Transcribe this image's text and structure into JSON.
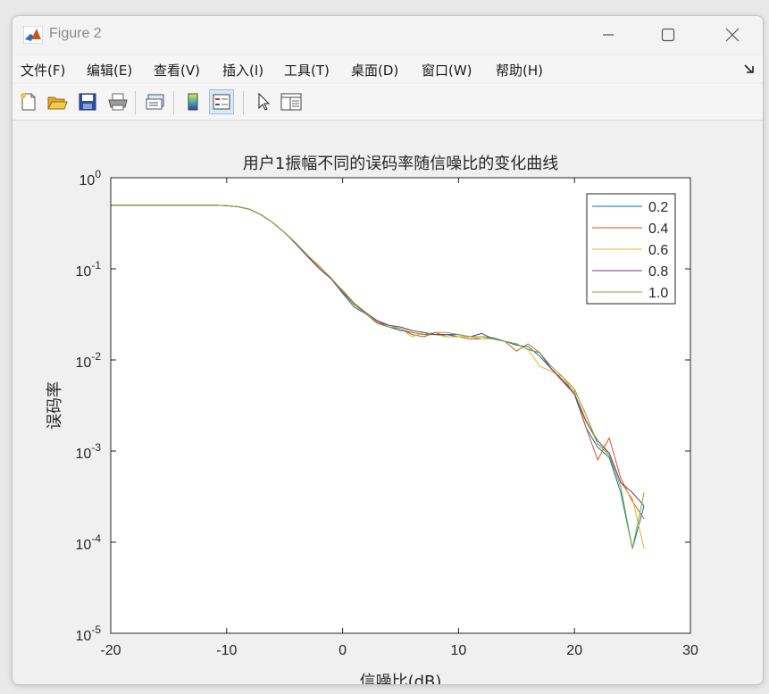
{
  "window": {
    "title": "Figure 2",
    "minimize_label": "",
    "maximize_label": "",
    "close_label": ""
  },
  "menu": {
    "items": [
      {
        "id": "file",
        "label": "文件(F)"
      },
      {
        "id": "edit",
        "label": "编辑(E)"
      },
      {
        "id": "view",
        "label": "查看(V)"
      },
      {
        "id": "insert",
        "label": "插入(I)"
      },
      {
        "id": "tools",
        "label": "工具(T)"
      },
      {
        "id": "desktop",
        "label": "桌面(D)"
      },
      {
        "id": "window",
        "label": "窗口(W)"
      },
      {
        "id": "help",
        "label": "帮助(H)"
      }
    ]
  },
  "toolbar": {
    "icons": [
      "new-figure-icon",
      "open-file-icon",
      "save-icon",
      "print-icon",
      "link-plot-icon",
      "insert-colorbar-icon",
      "insert-legend-icon",
      "edit-plot-icon",
      "property-inspector-icon"
    ]
  },
  "colors": {
    "series": [
      "#0072BD",
      "#D95319",
      "#EDB120",
      "#7E2F8E",
      "#77AC30"
    ]
  },
  "chart_data": {
    "type": "line",
    "title": "用户1振幅不同的误码率随信噪比的变化曲线",
    "xlabel": "信噪比(dB)",
    "ylabel": "误码率",
    "xlim": [
      -20,
      30
    ],
    "ylim": [
      1e-05,
      1
    ],
    "yscale": "log",
    "xticks": [
      "-20",
      "-10",
      "0",
      "10",
      "20",
      "30"
    ],
    "yticks": [
      {
        "base": "10",
        "exp": "0"
      },
      {
        "base": "10",
        "exp": "-1"
      },
      {
        "base": "10",
        "exp": "-2"
      },
      {
        "base": "10",
        "exp": "-3"
      },
      {
        "base": "10",
        "exp": "-4"
      },
      {
        "base": "10",
        "exp": "-5"
      }
    ],
    "grid": false,
    "legend_position": "top-right",
    "x": [
      -20,
      -19,
      -18,
      -17,
      -16,
      -15,
      -14,
      -13,
      -12,
      -11,
      -10,
      -9,
      -8,
      -7,
      -6,
      -5,
      -4,
      -3,
      -2,
      -1,
      0,
      1,
      2,
      3,
      4,
      5,
      6,
      7,
      8,
      9,
      10,
      11,
      12,
      13,
      14,
      15,
      16,
      17,
      18,
      19,
      20,
      21,
      22,
      23,
      24,
      25,
      26
    ],
    "series": [
      {
        "name": "0.2",
        "values": [
          0.5,
          0.5,
          0.5,
          0.5,
          0.5,
          0.5,
          0.5,
          0.5,
          0.5,
          0.5,
          0.495,
          0.48,
          0.45,
          0.39,
          0.32,
          0.25,
          0.19,
          0.14,
          0.105,
          0.078,
          0.054,
          0.038,
          0.032,
          0.026,
          0.023,
          0.021,
          0.02,
          0.019,
          0.019,
          0.019,
          0.018,
          0.018,
          0.018,
          0.0175,
          0.016,
          0.0145,
          0.014,
          0.011,
          0.008,
          0.006,
          0.0042,
          0.0018,
          0.0011,
          0.00085,
          0.00035,
          8.5e-05,
          0.00025
        ]
      },
      {
        "name": "0.4",
        "values": [
          0.5,
          0.5,
          0.5,
          0.5,
          0.5,
          0.5,
          0.5,
          0.5,
          0.5,
          0.5,
          0.495,
          0.48,
          0.45,
          0.39,
          0.32,
          0.25,
          0.19,
          0.135,
          0.105,
          0.078,
          0.058,
          0.042,
          0.033,
          0.026,
          0.024,
          0.022,
          0.019,
          0.018,
          0.02,
          0.018,
          0.018,
          0.017,
          0.017,
          0.017,
          0.016,
          0.0125,
          0.015,
          0.012,
          0.008,
          0.006,
          0.0045,
          0.0018,
          0.0008,
          0.0014,
          0.0005,
          0.00028,
          0.00018
        ]
      },
      {
        "name": "0.6",
        "values": [
          0.5,
          0.5,
          0.5,
          0.5,
          0.5,
          0.5,
          0.5,
          0.5,
          0.5,
          0.5,
          0.495,
          0.48,
          0.45,
          0.39,
          0.32,
          0.25,
          0.19,
          0.14,
          0.108,
          0.078,
          0.055,
          0.04,
          0.032,
          0.027,
          0.024,
          0.022,
          0.018,
          0.02,
          0.019,
          0.018,
          0.018,
          0.018,
          0.017,
          0.017,
          0.016,
          0.015,
          0.013,
          0.0085,
          0.0075,
          0.0065,
          0.0044,
          0.0022,
          0.0012,
          0.00095,
          0.00045,
          0.0003,
          8.5e-05
        ]
      },
      {
        "name": "0.8",
        "values": [
          0.5,
          0.5,
          0.5,
          0.5,
          0.5,
          0.5,
          0.5,
          0.5,
          0.5,
          0.5,
          0.495,
          0.48,
          0.45,
          0.39,
          0.32,
          0.25,
          0.185,
          0.135,
          0.1,
          0.078,
          0.055,
          0.041,
          0.033,
          0.027,
          0.024,
          0.023,
          0.021,
          0.02,
          0.019,
          0.019,
          0.019,
          0.018,
          0.0195,
          0.017,
          0.016,
          0.015,
          0.013,
          0.012,
          0.008,
          0.0058,
          0.0042,
          0.0021,
          0.0013,
          0.00095,
          0.00045,
          0.00035,
          0.00025
        ]
      },
      {
        "name": "1.0",
        "values": [
          0.5,
          0.5,
          0.5,
          0.5,
          0.5,
          0.5,
          0.5,
          0.5,
          0.5,
          0.5,
          0.495,
          0.48,
          0.45,
          0.39,
          0.32,
          0.25,
          0.19,
          0.14,
          0.105,
          0.08,
          0.057,
          0.041,
          0.032,
          0.025,
          0.023,
          0.022,
          0.02,
          0.019,
          0.02,
          0.02,
          0.019,
          0.018,
          0.018,
          0.017,
          0.016,
          0.015,
          0.013,
          0.012,
          0.0085,
          0.0065,
          0.0048,
          0.0025,
          0.0012,
          0.0009,
          0.0004,
          8.5e-05,
          0.00035
        ]
      }
    ]
  }
}
